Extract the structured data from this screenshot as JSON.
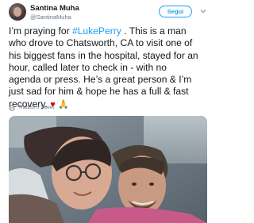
{
  "author": {
    "display_name": "Santina Muha",
    "handle": "@SantinaMuha"
  },
  "follow_button": {
    "label": "Segui"
  },
  "tweet": {
    "line1_before": "I’m praying for ",
    "hashtag": "#LukePerry",
    "line1_after": " . This is a man",
    "line2": "who drove to Chatsworth, CA to visit one of",
    "line3": "his biggest fans in the hospital, stayed for an",
    "line4": "hour, called later to check in - with no",
    "line5": "agenda or press. He’s a great person & I’m",
    "line6": "just sad for him & hope he has a full & fast",
    "line7": "recovery.",
    "emoji_heart": "♥",
    "emoji_hands": "🙏"
  },
  "translate": {
    "label": "Traduci il Tweet"
  },
  "icons": {
    "avatar": "profile-photo",
    "caret": "chevron-down-icon",
    "globe": "globe-icon",
    "photo": "selfie-photo"
  },
  "colors": {
    "accent": "#1da1f2",
    "text": "#14171a",
    "secondary": "#657786",
    "heart": "#d0021b"
  }
}
